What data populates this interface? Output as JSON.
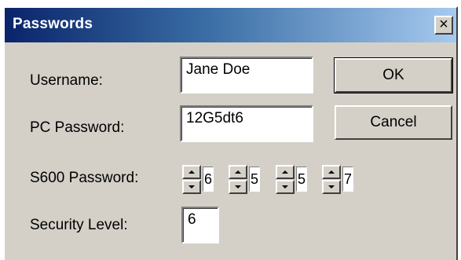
{
  "window": {
    "title": "Passwords",
    "close_symbol": "×"
  },
  "fields": {
    "username_label": "Username:",
    "username_value": "Jane Doe",
    "pc_password_label": "PC Password:",
    "pc_password_value": "12G5dt6",
    "s600_password_label": "S600 Password:",
    "s600_digits": [
      "6",
      "5",
      "5",
      "7"
    ],
    "security_level_label": "Security Level:",
    "security_level_value": "6"
  },
  "buttons": {
    "ok_label": "OK",
    "cancel_label": "Cancel"
  },
  "icons": {
    "close": "close-icon",
    "spin_up": "spin-up-arrow-icon",
    "spin_down": "spin-down-arrow-icon"
  },
  "colors": {
    "title_gradient_start": "#0a246a",
    "title_gradient_end": "#a6caf0",
    "dialog_background": "#d4d0c8"
  }
}
